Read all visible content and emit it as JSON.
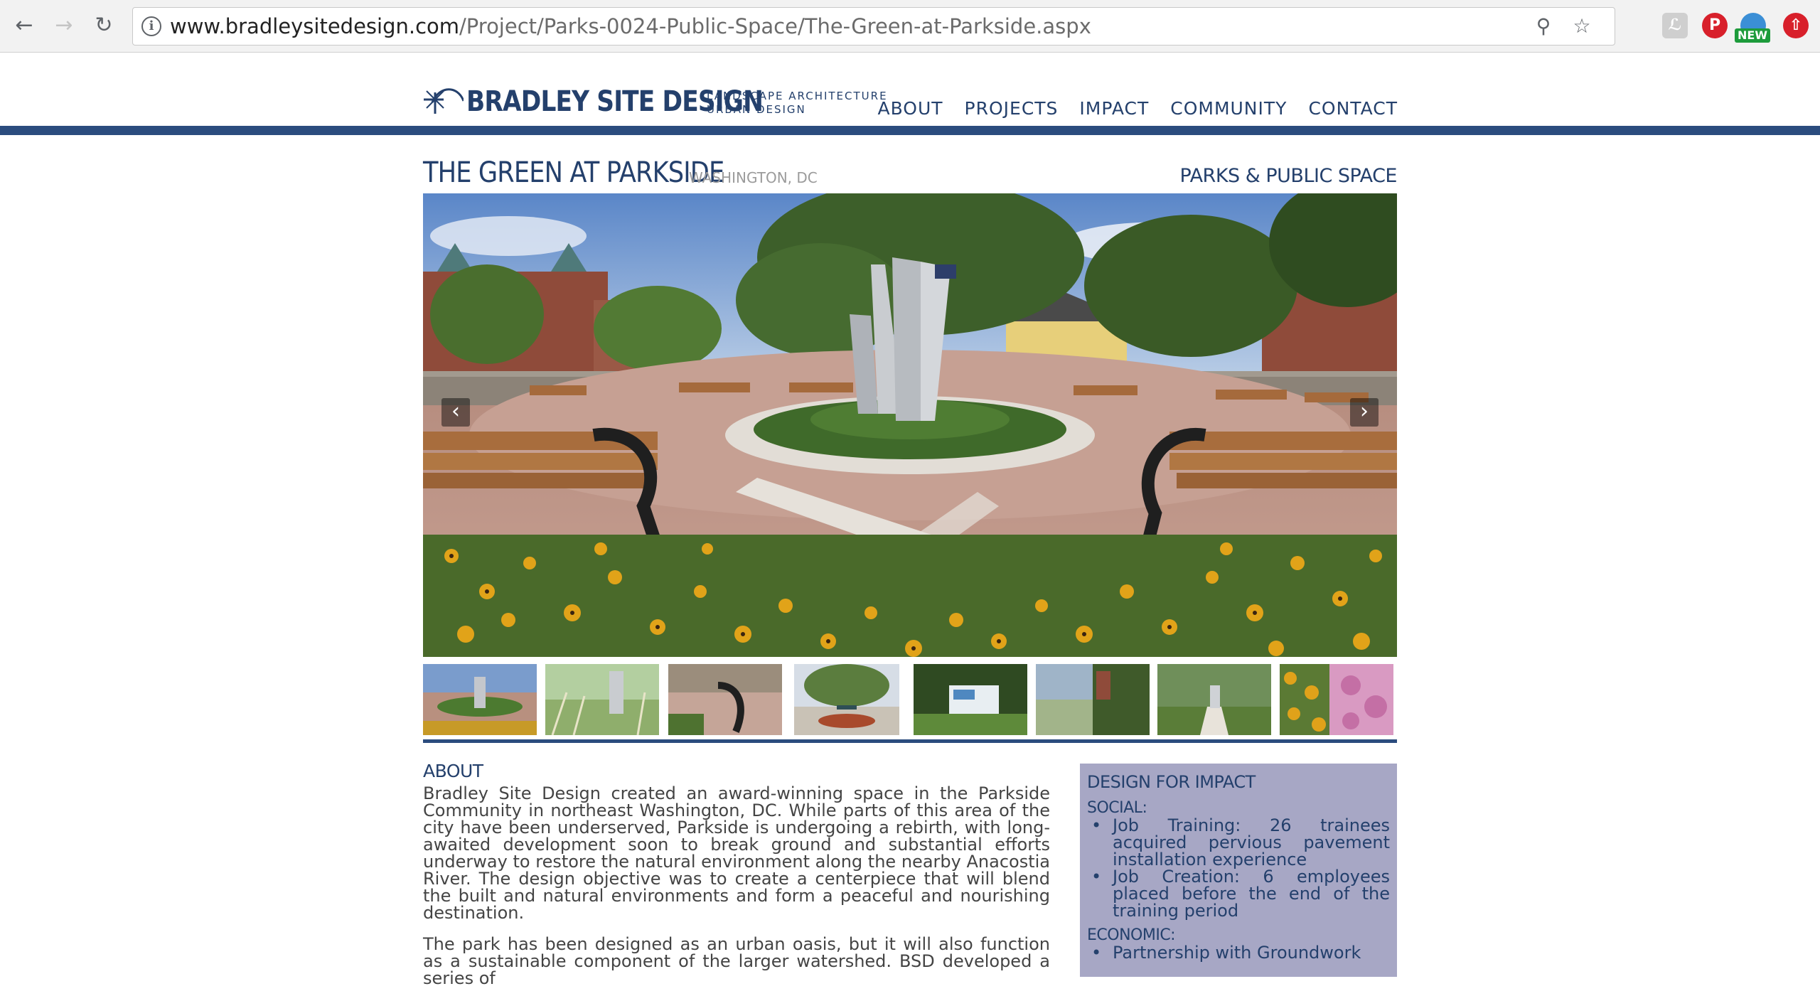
{
  "browser": {
    "url_host": "www.bradleysitedesign.com",
    "url_path": "/Project/Parks-0024-Public-Space/The-Green-at-Parkside.aspx",
    "back_icon": "arrow-left-icon",
    "forward_icon": "arrow-right-icon",
    "reload_icon": "reload-icon",
    "zoom_icon": "zoom-icon",
    "star_icon": "star-icon",
    "extension_badge": "NEW"
  },
  "site": {
    "logo_name": "BRADLEY SITE DESIGN",
    "logo_tagline_1": "LANDSCAPE ARCHITECTURE",
    "logo_tagline_2": "URBAN DESIGN",
    "nav": [
      "ABOUT",
      "PROJECTS",
      "IMPACT",
      "COMMUNITY",
      "CONTACT"
    ],
    "brand_color": "#2b4c7e"
  },
  "project": {
    "title": "THE GREEN AT PARKSIDE",
    "location": "WASHINGTON, DC",
    "category": "PARKS & PUBLIC SPACE",
    "prev_label": "‹",
    "next_label": "›",
    "thumbnail_count": 8
  },
  "about": {
    "heading": "ABOUT",
    "paragraph_1": "Bradley Site Design created an award-winning space in the Parkside Community in northeast Washington, DC. While parts of this area of the city have been underserved, Parkside is undergoing a rebirth, with long-awaited development soon to break ground and substantial efforts underway to restore the natural environment along the nearby Anacostia River. The design objective was to create a centerpiece that will blend the built and natural environments and form a peaceful and nourishing destination.",
    "paragraph_2": "The park has been designed as an urban oasis, but it will also function as a sustainable component of the larger watershed. BSD developed a series of"
  },
  "impact": {
    "heading": "DESIGN FOR IMPACT",
    "social_label": "SOCIAL:",
    "social_items": [
      "Job Training: 26 trainees acquired pervious pavement installation experience",
      "Job Creation: 6 employees placed before the end of the training period"
    ],
    "economic_label": "ECONOMIC:",
    "economic_items": [
      "Partnership with Groundwork"
    ]
  }
}
